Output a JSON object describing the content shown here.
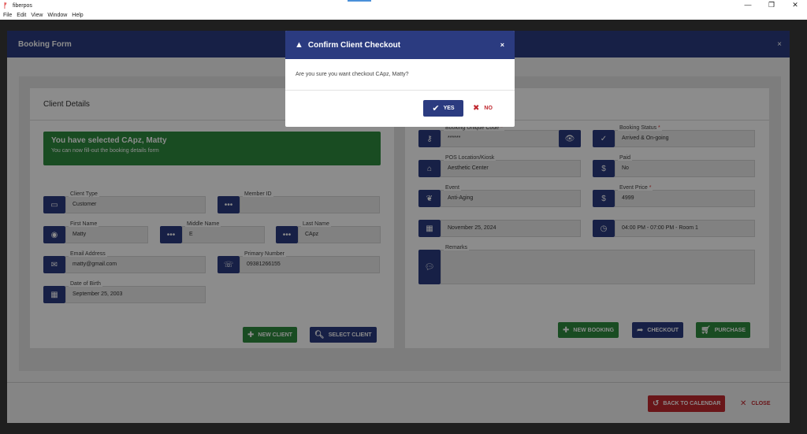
{
  "window": {
    "title": "fiberpos",
    "minimize": "—",
    "maximize": "❐",
    "close": "✕"
  },
  "menu": [
    "File",
    "Edit",
    "View",
    "Window",
    "Help"
  ],
  "booking_form": {
    "title": "Booking Form",
    "close": "×",
    "client_details": {
      "title": "Client Details",
      "alert_title": "You have selected CApz, Matty",
      "alert_sub": "You can now fill-out the booking details form",
      "client_type": {
        "label": "Client Type",
        "value": "Customer"
      },
      "member_id": {
        "label": "Member ID",
        "value": ""
      },
      "first_name": {
        "label": "First Name",
        "value": "Matty"
      },
      "middle_name": {
        "label": "Middle Name",
        "value": "E"
      },
      "last_name": {
        "label": "Last Name",
        "value": "CApz"
      },
      "email": {
        "label": "Email Address",
        "value": "matty@gmail.com"
      },
      "primary_number": {
        "label": "Primary Number",
        "value": "09381266155"
      },
      "dob": {
        "label": "Date of Birth",
        "value": "September 25, 2003"
      },
      "new_client": "NEW CLIENT",
      "select_client": "SELECT CLIENT"
    },
    "booking_details": {
      "unique_code": {
        "label": "Booking Unique Code",
        "value": "******",
        "required": "*"
      },
      "status": {
        "label": "Booking Status",
        "value": "Arrived & On-going",
        "required": "*"
      },
      "location": {
        "label": "POS Location/Kiosk",
        "value": "Aesthetic Center"
      },
      "paid": {
        "label": "Paid",
        "value": "No"
      },
      "event": {
        "label": "Event",
        "value": "Anti-Aging"
      },
      "price": {
        "label": "Event Price",
        "value": "4999",
        "required": "*"
      },
      "date": {
        "value": "November 25, 2024"
      },
      "time": {
        "value": "04:00 PM - 07:00 PM - Room 1"
      },
      "remarks": {
        "label": "Remarks",
        "value": ""
      },
      "new_booking": "NEW BOOKING",
      "checkout": "CHECKOUT",
      "purchase": "PURCHASE"
    },
    "back_to_calendar": "BACK TO CALENDAR",
    "close_label": "CLOSE"
  },
  "confirm": {
    "title": "Confirm Client Checkout",
    "close": "×",
    "message": "Are you sure you want checkout CApz, Matty?",
    "yes": "YES",
    "no": "NO"
  },
  "colors": {
    "navy": "#2b3b80",
    "green": "#2e8b3e",
    "red": "#c0282f"
  }
}
